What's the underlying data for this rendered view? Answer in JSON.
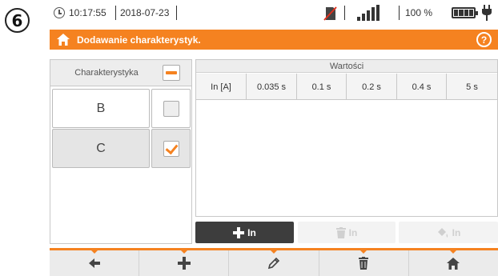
{
  "step": "6",
  "statusbar": {
    "time": "10:17:55",
    "date": "2018-07-23",
    "battery_pct": "100 %",
    "icons": [
      "clock-icon",
      "sd-card-disabled-icon",
      "signal-icon",
      "battery-icon",
      "plug-icon"
    ]
  },
  "titlebar": {
    "title": "Dodawanie charakterystyk.",
    "help": "?",
    "icons": [
      "home-icon",
      "help-icon"
    ]
  },
  "characteristics": {
    "header": "Charakterystyka",
    "rows": [
      {
        "name": "B",
        "checked": false
      },
      {
        "name": "C",
        "checked": true
      }
    ]
  },
  "values_table": {
    "header": "Wartości",
    "columns": [
      "In [A]",
      "0.035 s",
      "0.1 s",
      "0.2 s",
      "0.4 s",
      "5 s"
    ]
  },
  "actions": {
    "add_label": "In",
    "delete_label": "In",
    "edit_label": "In"
  },
  "toolbar": {
    "buttons": [
      "back-icon",
      "add-icon",
      "edit-icon",
      "delete-icon",
      "home-icon"
    ]
  },
  "colors": {
    "accent": "#f58220",
    "dark_button": "#3d3d3d",
    "panel_header": "#ededed"
  }
}
